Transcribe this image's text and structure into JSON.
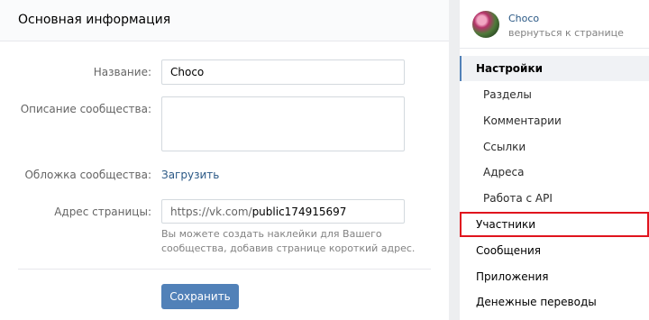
{
  "main": {
    "title": "Основная информация",
    "name_label": "Название:",
    "name_value": "Choco",
    "description_label": "Описание сообщества:",
    "description_value": "",
    "cover_label": "Обложка сообщества:",
    "cover_link": "Загрузить",
    "address_label": "Адрес страницы:",
    "address_prefix": "https://vk.com/",
    "address_value": "public174915697",
    "address_hint": "Вы можете создать наклейки для Вашего сообщества, добавив странице короткий адрес.",
    "save_label": "Сохранить"
  },
  "sidebar": {
    "group_name": "Choco",
    "back_label": "вернуться к странице",
    "items": [
      {
        "label": "Настройки"
      },
      {
        "label": "Разделы"
      },
      {
        "label": "Комментарии"
      },
      {
        "label": "Ссылки"
      },
      {
        "label": "Адреса"
      },
      {
        "label": "Работа с API"
      },
      {
        "label": "Участники"
      },
      {
        "label": "Сообщения"
      },
      {
        "label": "Приложения"
      },
      {
        "label": "Денежные переводы"
      }
    ]
  },
  "colors": {
    "accent": "#5181b8",
    "link": "#2a5885",
    "highlight": "#e0141e"
  }
}
